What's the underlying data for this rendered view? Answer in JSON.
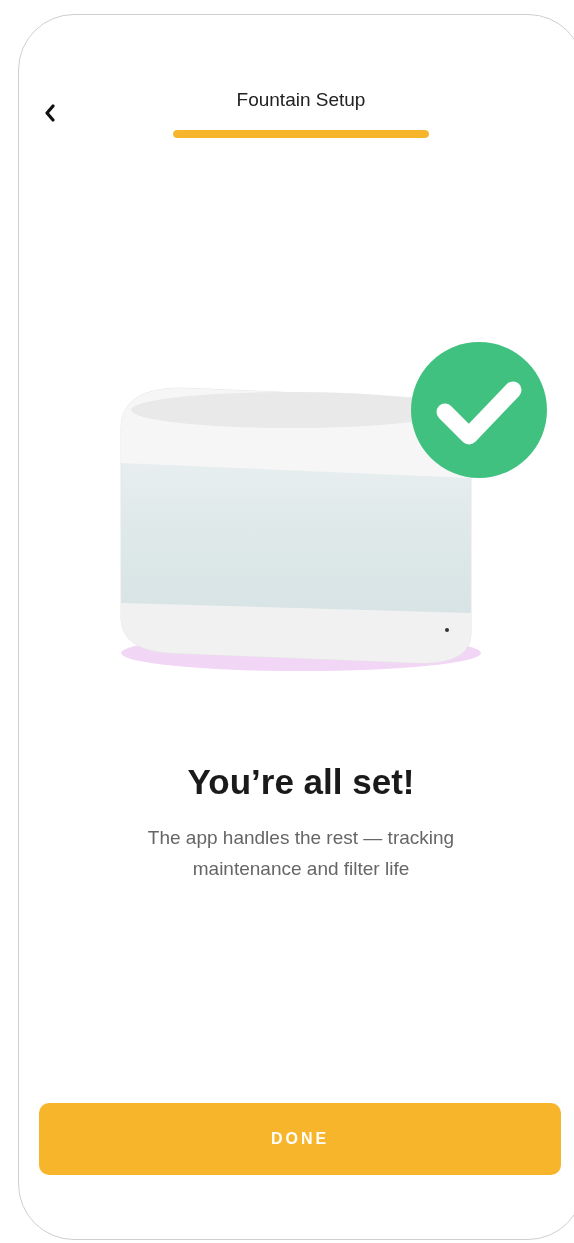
{
  "header": {
    "title": "Fountain Setup",
    "progress": {
      "level": 1
    }
  },
  "message": {
    "heading": "You’re all set!",
    "body": "The app handles the rest — tracking maintenance and filter life"
  },
  "primary_button": {
    "label": "DONE"
  }
}
